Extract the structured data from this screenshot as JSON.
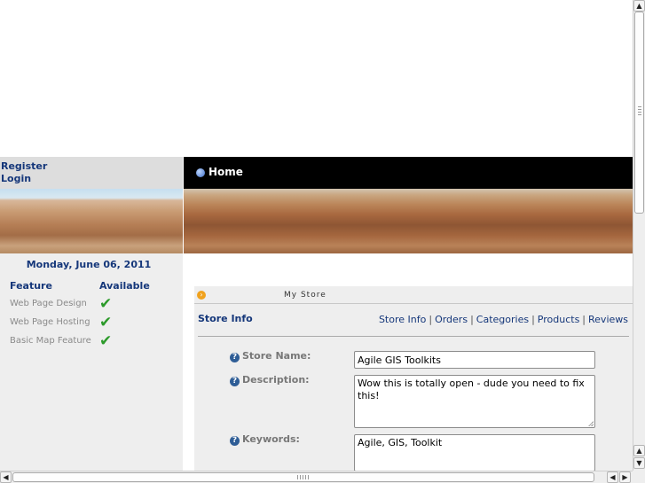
{
  "sidebar": {
    "register_label": "Register",
    "login_label": "Login",
    "date": "Monday, June 06, 2011",
    "feature_header": "Feature",
    "available_header": "Available",
    "features": [
      {
        "name": "Web Page Design",
        "available": "✔"
      },
      {
        "name": "Web Page Hosting",
        "available": "✔"
      },
      {
        "name": "Basic Map Feature",
        "available": "✔"
      }
    ]
  },
  "nav": {
    "home_label": "Home"
  },
  "store": {
    "title": "My Store",
    "section_label": "Store Info",
    "links": [
      "Store Info",
      "Orders",
      "Categories",
      "Products",
      "Reviews"
    ],
    "separator": "|",
    "help_glyph": "?",
    "fields": {
      "store_name_label": "Store Name:",
      "store_name_value": "Agile GIS Toolkits",
      "description_label": "Description:",
      "description_value": "Wow this is totally open - dude you need to fix this!",
      "keywords_label": "Keywords:",
      "keywords_value": "Agile, GIS, Toolkit"
    }
  },
  "icons": {
    "home": "home-bullet-icon",
    "store_header": "arrow-circle-icon",
    "help": "help-icon",
    "check": "check-icon"
  },
  "colors": {
    "link_blue": "#15377a",
    "check_green": "#2c9a2a",
    "nav_bg": "#000000",
    "panel_bg": "#eeeeee"
  }
}
